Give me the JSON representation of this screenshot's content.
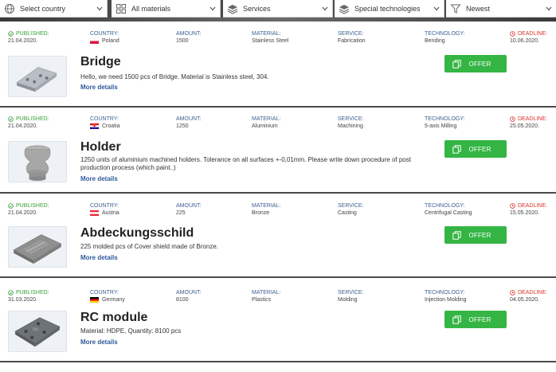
{
  "filters": [
    {
      "label": "Select country",
      "icon": "globe-icon"
    },
    {
      "label": "All materials",
      "icon": "grid-icon"
    },
    {
      "label": "Services",
      "icon": "layers-icon"
    },
    {
      "label": "Special technologies",
      "icon": "layers-icon"
    },
    {
      "label": "Newest",
      "icon": "filter-icon"
    }
  ],
  "labels": {
    "published": "PUBLISHED:",
    "country": "COUNTRY:",
    "amount": "AMOUNT:",
    "material": "MATERIAL:",
    "service": "SERVICE:",
    "technology": "TECHNOLOGY:",
    "deadline": "DEADLINE:",
    "more": "More details",
    "offer": "OFFER"
  },
  "colors": {
    "accent_green": "#35b543",
    "published_green": "#3aa03a",
    "deadline_red": "#d9342b",
    "label_blue": "#3d5f92",
    "link_blue": "#2e5a9a"
  },
  "listings": [
    {
      "published": "21.04.2020.",
      "country": "Poland",
      "flag": "poland",
      "amount": "1500",
      "material": "Stainless Steel",
      "service": "Fabrication",
      "technology": "Bending",
      "deadline": "10.06.2020.",
      "title": "Bridge",
      "description": "Hello, we need 1500 pcs of Bridge. Material is Stainless steel, 304.",
      "image": "bent-bracket-part"
    },
    {
      "published": "21.04.2020.",
      "country": "Croatia",
      "flag": "croatia",
      "amount": "1250",
      "material": "Aluminium",
      "service": "Machining",
      "technology": "5-axis Milling",
      "deadline": "25.05.2020.",
      "title": "Holder",
      "description": "1250 units of aluminium machined holders. Tolerance on all surfaces +-0,01mm. Please write down procedure of post production process (which paint..)",
      "image": "turned-holder-part"
    },
    {
      "published": "21.04.2020.",
      "country": "Austria",
      "flag": "austria",
      "amount": "225",
      "material": "Bronze",
      "service": "Casting",
      "technology": "Centrifugal Casting",
      "deadline": "15.05.2020.",
      "title": "Abdeckungsschild",
      "description": "225 molded pcs of Cover shield made of Bronze.",
      "image": "cover-shield-part"
    },
    {
      "published": "31.03.2020.",
      "country": "Germany",
      "flag": "germany",
      "amount": "8100",
      "material": "Plastics",
      "service": "Molding",
      "technology": "Injection Molding",
      "deadline": "04.05.2020.",
      "title": "RC module",
      "description": "Material: HDPE, Quantity: 8100 pcs",
      "image": "rc-module-part"
    }
  ]
}
